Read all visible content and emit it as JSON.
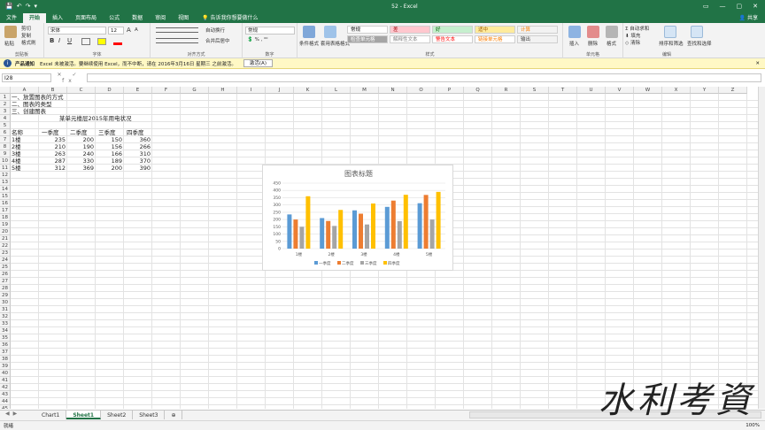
{
  "window": {
    "title": "52 - Excel",
    "quick_access": [
      "💾",
      "↶",
      "↷",
      "▾"
    ],
    "controls": [
      "▭",
      "—",
      "▢",
      "✕"
    ]
  },
  "ribbon_tabs": [
    "文件",
    "开始",
    "插入",
    "页面布局",
    "公式",
    "数据",
    "审阅",
    "视图"
  ],
  "active_tab": "开始",
  "tell_me": "告诉我你想要做什么",
  "share": "共享",
  "clipboard": {
    "paste": "粘贴",
    "cut": "剪切",
    "copy": "复制",
    "format_painter": "格式刷",
    "label": "剪贴板"
  },
  "font": {
    "name": "宋体",
    "size": "12",
    "bold": "B",
    "italic": "I",
    "underline": "U",
    "grow": "A",
    "shrink": "A",
    "label": "字体"
  },
  "alignment": {
    "wrap": "自动换行",
    "merge": "合并后居中",
    "label": "对齐方式"
  },
  "number": {
    "format": "常规",
    "label": "数字"
  },
  "styles": {
    "cond_format": "条件格式",
    "table_format": "套用表格格式",
    "cells": [
      {
        "text": "常规",
        "bg": "#ffffff",
        "color": "#000000"
      },
      {
        "text": "差",
        "bg": "#ffc7ce",
        "color": "#9c0006"
      },
      {
        "text": "好",
        "bg": "#c6efce",
        "color": "#006100"
      },
      {
        "text": "适中",
        "bg": "#ffeb9c",
        "color": "#9c5700"
      },
      {
        "text": "计算",
        "bg": "#f2f2f2",
        "color": "#fa7d00"
      },
      {
        "text": "检查单元格",
        "bg": "#a5a5a5",
        "color": "#ffffff"
      },
      {
        "text": "解释性文本",
        "bg": "#ffffff",
        "color": "#7f7f7f"
      },
      {
        "text": "警告文本",
        "bg": "#ffffff",
        "color": "#ff0000"
      },
      {
        "text": "链接单元格",
        "bg": "#ffffff",
        "color": "#fa7d00"
      },
      {
        "text": "输出",
        "bg": "#f2f2f2",
        "color": "#3f3f3f"
      }
    ],
    "label": "样式"
  },
  "cells_group": {
    "insert": "插入",
    "delete": "删除",
    "format": "格式",
    "label": "单元格"
  },
  "editing": {
    "autosum": "自动求和",
    "fill": "填充",
    "clear": "清除",
    "sort": "排序和筛选",
    "find": "查找和选择",
    "label": "编辑"
  },
  "message_bar": {
    "title": "产品通知",
    "text": "Excel 未被激活。要继续使用 Excel，而不中断，请在 2016年3月16日 星期三 之前激活。",
    "button": "激活(A)",
    "close": "✕"
  },
  "formula_bar": {
    "name_box": "I28",
    "fx": "✕ ✓ fx",
    "value": ""
  },
  "columns": [
    "A",
    "B",
    "C",
    "D",
    "E",
    "F",
    "G",
    "H",
    "I",
    "J",
    "K",
    "L",
    "M",
    "N",
    "O",
    "P",
    "Q",
    "R",
    "S",
    "T",
    "U",
    "V",
    "W",
    "X",
    "Y",
    "Z"
  ],
  "row_count": 45,
  "sheet": {
    "notes": [
      "一、放置图表的方式",
      "二、图表的类型",
      "三、创建图表"
    ],
    "table_title": "某单元楼层2015年用电状况",
    "header": [
      "名称",
      "一季度",
      "二季度",
      "三季度",
      "四季度"
    ],
    "rows": [
      [
        "1楼",
        "235",
        "200",
        "150",
        "360"
      ],
      [
        "2楼",
        "210",
        "190",
        "156",
        "266"
      ],
      [
        "3楼",
        "263",
        "240",
        "166",
        "310"
      ],
      [
        "4楼",
        "287",
        "330",
        "189",
        "370"
      ],
      [
        "5楼",
        "312",
        "369",
        "200",
        "390"
      ]
    ]
  },
  "chart_data": {
    "type": "bar",
    "title": "图表标题",
    "categories": [
      "1楼",
      "2楼",
      "3楼",
      "4楼",
      "5楼"
    ],
    "series": [
      {
        "name": "一季度",
        "values": [
          235,
          210,
          263,
          287,
          312
        ],
        "color": "#5b9bd5"
      },
      {
        "name": "二季度",
        "values": [
          200,
          190,
          240,
          330,
          369
        ],
        "color": "#ed7d31"
      },
      {
        "name": "三季度",
        "values": [
          150,
          156,
          166,
          189,
          200
        ],
        "color": "#a5a5a5"
      },
      {
        "name": "四季度",
        "values": [
          360,
          266,
          310,
          370,
          390
        ],
        "color": "#ffc000"
      }
    ],
    "ylim": [
      0,
      450
    ],
    "yticks": [
      0,
      50,
      100,
      150,
      200,
      250,
      300,
      350,
      400,
      450
    ],
    "grid": true,
    "legend": "bottom"
  },
  "sheet_tabs": [
    "Chart1",
    "Sheet1",
    "Sheet2",
    "Sheet3"
  ],
  "active_sheet": "Sheet1",
  "status": {
    "mode": "就绪",
    "zoom": "100%"
  },
  "watermark": "水利考資"
}
